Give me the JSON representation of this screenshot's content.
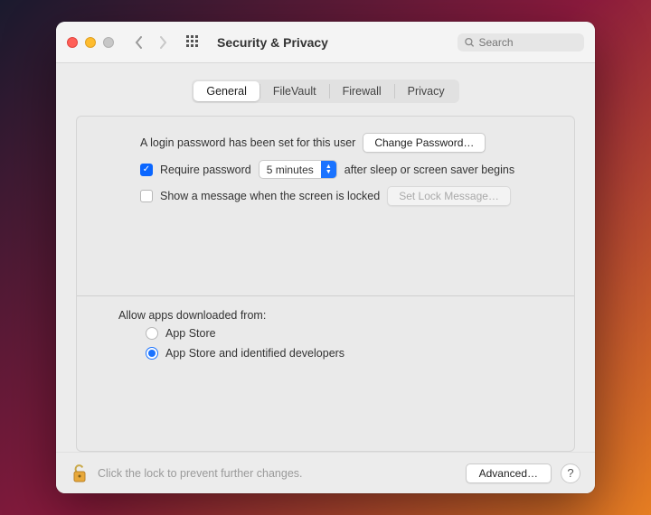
{
  "window": {
    "title": "Security & Privacy",
    "search_placeholder": "Search"
  },
  "tabs": [
    "General",
    "FileVault",
    "Firewall",
    "Privacy"
  ],
  "active_tab": 0,
  "general": {
    "login_pw_text": "A login password has been set for this user",
    "change_pw_btn": "Change Password…",
    "require_pw_label_pre": "Require password",
    "require_pw_delay": "5 minutes",
    "require_pw_label_post": "after sleep or screen saver begins",
    "require_pw_checked": true,
    "show_msg_label": "Show a message when the screen is locked",
    "show_msg_checked": false,
    "set_lock_msg_btn": "Set Lock Message…",
    "allow_heading": "Allow apps downloaded from:",
    "allow_options": {
      "appstore": "App Store",
      "identified": "App Store and identified developers"
    },
    "allow_selected": "identified"
  },
  "footer": {
    "lock_text": "Click the lock to prevent further changes.",
    "advanced_btn": "Advanced…",
    "help_btn": "?"
  }
}
